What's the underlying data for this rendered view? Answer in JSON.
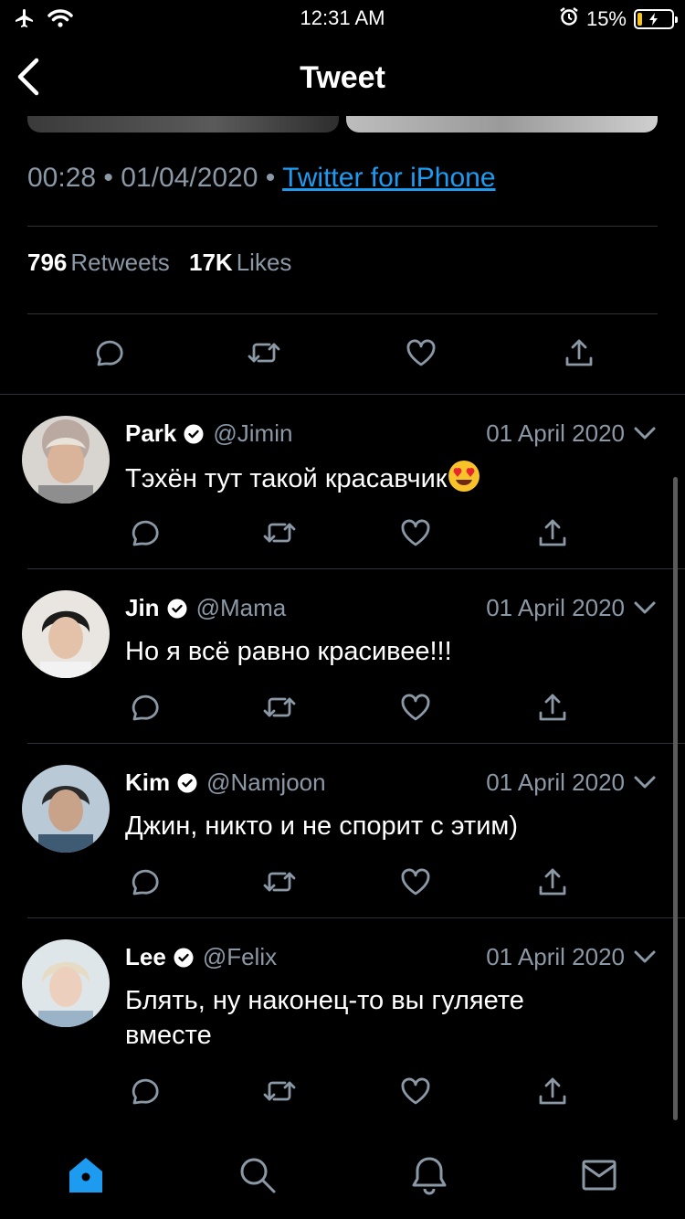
{
  "status_bar": {
    "time": "12:31 AM",
    "battery": "15%",
    "battery_level": 0.15,
    "battery_color": "#f5c518",
    "icons": [
      "airplane-icon",
      "wifi-icon",
      "alarm-icon",
      "battery-icon"
    ]
  },
  "header": {
    "title": "Tweet",
    "back_icon": "chevron-left-icon"
  },
  "tweet": {
    "time": "00:28",
    "date": "01/04/2020",
    "separator": "•",
    "source": "Twitter for iPhone",
    "retweets_count": "796",
    "retweets_label": "Retweets",
    "likes_count": "17K",
    "likes_label": "Likes"
  },
  "replies": [
    {
      "name": "Park",
      "handle": "@Jimin",
      "date": "01 April 2020",
      "text": "Тэхён тут такой красавчик",
      "emoji": "heart-eyes-emoji"
    },
    {
      "name": "Jin",
      "handle": "@Mama",
      "date": "01 April 2020",
      "text": "Но я всё равно красивее!!!"
    },
    {
      "name": "Kim",
      "handle": "@Namjoon",
      "date": "01 April 2020",
      "text": "Джин, никто и не спорит с этим)"
    },
    {
      "name": "Lee",
      "handle": "@Felix",
      "date": "01 April 2020",
      "text": "Блять, ну наконец-то вы гуляете вместе"
    }
  ],
  "tabs": [
    "home-icon",
    "search-icon",
    "notifications-icon",
    "messages-icon"
  ],
  "colors": {
    "accent": "#1d9bf0",
    "muted": "#8b98a5",
    "background": "#000000",
    "divider": "#2f3336"
  }
}
